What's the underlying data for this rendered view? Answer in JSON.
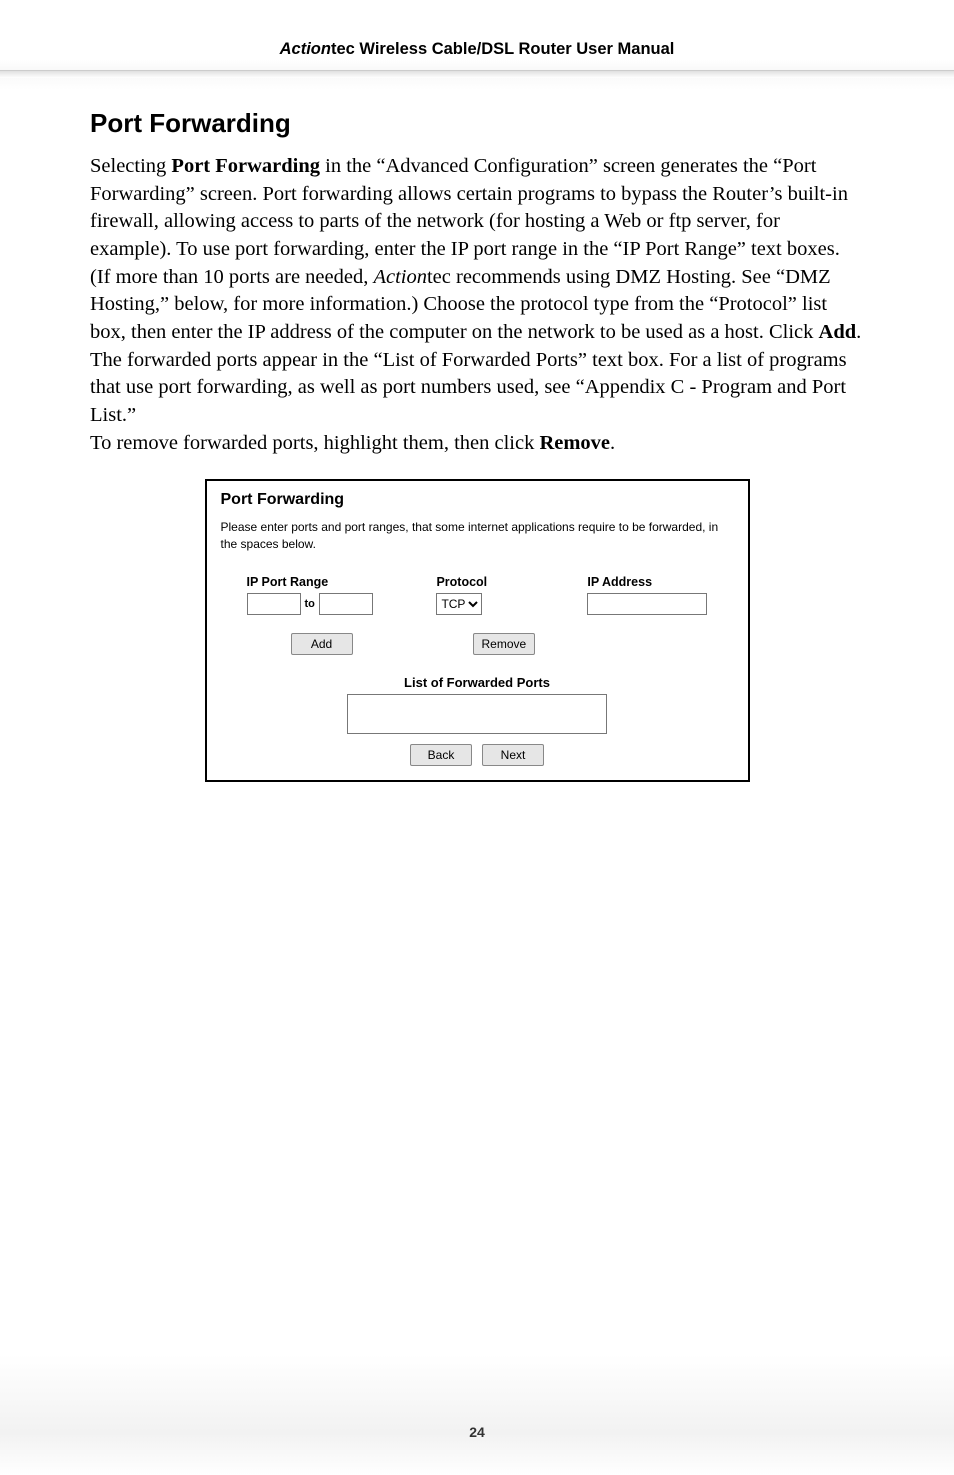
{
  "header": {
    "brand_italic": "Action",
    "brand_rest": "tec",
    "title_rest": " Wireless Cable/DSL Router User Manual"
  },
  "section": {
    "title": "Port Forwarding",
    "body_html": "Selecting <b>Port Forwarding</b> in the “Advanced Configuration” screen generates the “Port Forwarding” screen. Port forwarding allows certain programs to bypass the Router’s built-in firewall, allowing access to parts of the network (for hosting a Web or ftp server, for example). To use port forwarding, enter the IP port range in the “IP Port Range” text boxes. (If more than 10 ports are needed, <i>Action</i>tec recommends using DMZ Hosting. See “DMZ Hosting,” below, for more information.) Choose the protocol type from the “Protocol” list box, then enter the IP address of the computer on the network to be used as a host. Click <b>Add</b>. The forwarded ports appear in the “List of Forwarded Ports” text box. For a list of programs that use port forwarding, as well as port numbers used, see “Appendix C - Program and Port List.”",
    "body_line2_html": "To remove forwarded ports, highlight them, then click <b>Remove</b>."
  },
  "panel": {
    "title": "Port Forwarding",
    "desc": "Please enter ports and port ranges, that some internet applications require to be forwarded, in the spaces below.",
    "headings": {
      "range": "IP Port Range",
      "proto": "Protocol",
      "ip": "IP Address"
    },
    "range_to": "to",
    "protocol_value": "TCP",
    "buttons": {
      "add": "Add",
      "remove": "Remove",
      "back": "Back",
      "next": "Next"
    },
    "forwarded_title": "List of Forwarded Ports"
  },
  "page_number": "24"
}
